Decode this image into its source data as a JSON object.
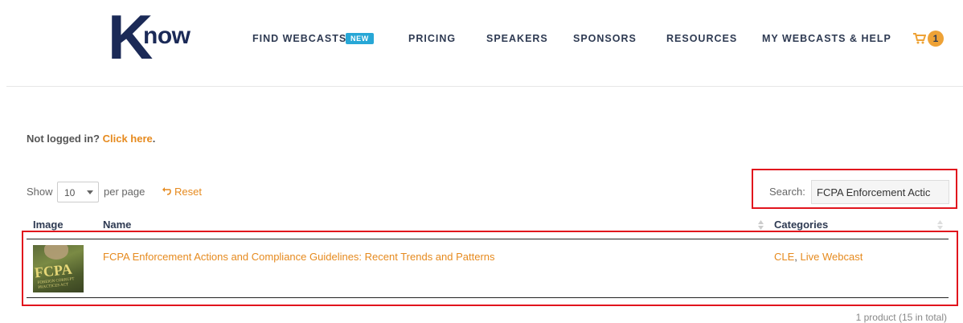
{
  "header": {
    "logo_text": "Know",
    "nav": [
      {
        "label": "FIND WEBCASTS",
        "badge": "NEW"
      },
      {
        "label": "PRICING"
      },
      {
        "label": "SPEAKERS"
      },
      {
        "label": "SPONSORS"
      },
      {
        "label": "RESOURCES"
      },
      {
        "label": "MY WEBCASTS & HELP"
      }
    ],
    "cart_icon": "cart-icon",
    "cart_count": "1"
  },
  "login": {
    "prompt": "Not logged in?",
    "link": "Click here",
    "suffix": "."
  },
  "controls": {
    "show_label": "Show",
    "per_page_value": "10",
    "per_page_label": "per page",
    "reset_label": "Reset",
    "search_label": "Search:",
    "search_value": "FCPA Enforcement Actic"
  },
  "table": {
    "columns": [
      "Image",
      "Name",
      "Categories"
    ],
    "rows": [
      {
        "thumb_text": "FCPA",
        "thumb_sub": "FOREIGN CORRUPT PRACTICES ACT",
        "name": "FCPA Enforcement Actions and Compliance Guidelines: Recent Trends and Patterns",
        "categories": [
          "CLE",
          "Live Webcast"
        ]
      }
    ],
    "total_text": "1 product (15 in total)"
  },
  "colors": {
    "accent": "#e68a1e",
    "navy": "#1b2a57",
    "badge_blue": "#27a7d6",
    "highlight_red": "#e1141d"
  }
}
